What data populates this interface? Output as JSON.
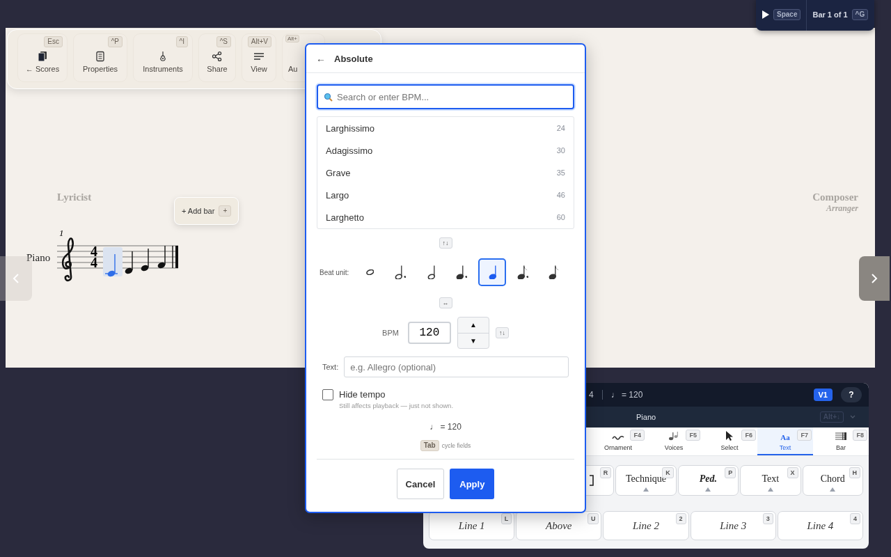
{
  "playback": {
    "play_key": "Space",
    "bar_label": "Bar 1 of 1",
    "bar_key": "^G"
  },
  "toolbar": [
    {
      "kind": "scores",
      "label": "← Scores",
      "key": "Esc"
    },
    {
      "kind": "properties",
      "label": "Properties",
      "key": "^P"
    },
    {
      "kind": "instruments",
      "label": "Instruments",
      "key": "^I"
    },
    {
      "kind": "share",
      "label": "Share",
      "key": "^S"
    },
    {
      "kind": "view",
      "label": "View",
      "key": "Alt+V"
    },
    {
      "kind": "audio",
      "label": "Au",
      "key": "Alt+"
    }
  ],
  "score": {
    "lyricist": "Lyricist",
    "composer": "Composer",
    "arranger": "Arranger",
    "bar_number": "1",
    "instrument": "Piano",
    "time_signature": [
      "4",
      "4"
    ],
    "notes": [
      {
        "selected": true
      },
      {
        "selected": false
      },
      {
        "selected": false
      },
      {
        "selected": false
      }
    ],
    "add_bar": {
      "label": "+ Add bar",
      "key": "+"
    }
  },
  "dialog": {
    "back": "←",
    "title": "Absolute",
    "search_placeholder": "Search or enter BPM...",
    "tempos": [
      {
        "name": "Larghissimo",
        "bpm": "24"
      },
      {
        "name": "Adagissimo",
        "bpm": "30"
      },
      {
        "name": "Grave",
        "bpm": "35"
      },
      {
        "name": "Largo",
        "bpm": "46"
      },
      {
        "name": "Larghetto",
        "bpm": "60"
      }
    ],
    "list_key": "↑↓",
    "beat_label": "Beat unit:",
    "beat_units": [
      {
        "kind": "whole",
        "selected": false
      },
      {
        "kind": "dotted-half",
        "selected": false
      },
      {
        "kind": "half",
        "selected": false
      },
      {
        "kind": "dotted-quarter",
        "selected": false
      },
      {
        "kind": "quarter",
        "selected": true
      },
      {
        "kind": "dotted-eighth",
        "selected": false
      },
      {
        "kind": "eighth",
        "selected": false
      }
    ],
    "beat_key": "↔",
    "bpm_label": "BPM",
    "bpm_value": "120",
    "step_up": "▲",
    "step_down": "▼",
    "bpm_key": "↑↓",
    "text_label": "Text:",
    "text_placeholder": "e.g. Allegro (optional)",
    "hide": {
      "label": "Hide tempo",
      "hint": "Still affects playback — just not shown.",
      "checked": false
    },
    "preview": "♩ = 120",
    "tab_key": "Tab",
    "tab_hint": "cycle fields",
    "cancel": "Cancel",
    "apply": "Apply"
  },
  "panel": {
    "status": "4",
    "tempo": "♩ = 120",
    "voice": "V1",
    "help": "?",
    "instrument": "Piano",
    "instrument_key": "Alt+↓",
    "tabs": [
      {
        "kind": "ornament",
        "label": "Ornament",
        "key": "F4",
        "selected": false
      },
      {
        "kind": "voices",
        "label": "Voices",
        "key": "F5",
        "selected": false
      },
      {
        "kind": "select",
        "label": "Select",
        "key": "F6",
        "selected": false
      },
      {
        "kind": "text",
        "glyph": "Aa",
        "label": "Text",
        "key": "F7",
        "selected": true
      },
      {
        "kind": "bar",
        "label": "Bar",
        "key": "F8",
        "selected": false
      }
    ],
    "buttons": [
      {
        "kind": "bracket",
        "key": "R"
      },
      {
        "kind": "label",
        "label": "Technique",
        "key": "K"
      },
      {
        "kind": "pedal",
        "label": "Ped.",
        "key": "P"
      },
      {
        "kind": "label",
        "label": "Text",
        "key": "X"
      },
      {
        "kind": "label",
        "label": "Chord",
        "key": "H"
      }
    ],
    "lines": [
      {
        "label": "Line 1",
        "key": "L"
      },
      {
        "label": "Above",
        "key": "U"
      },
      {
        "label": "Line 2",
        "key": "2"
      },
      {
        "label": "Line 3",
        "key": "3"
      },
      {
        "label": "Line 4",
        "key": "4"
      }
    ]
  }
}
